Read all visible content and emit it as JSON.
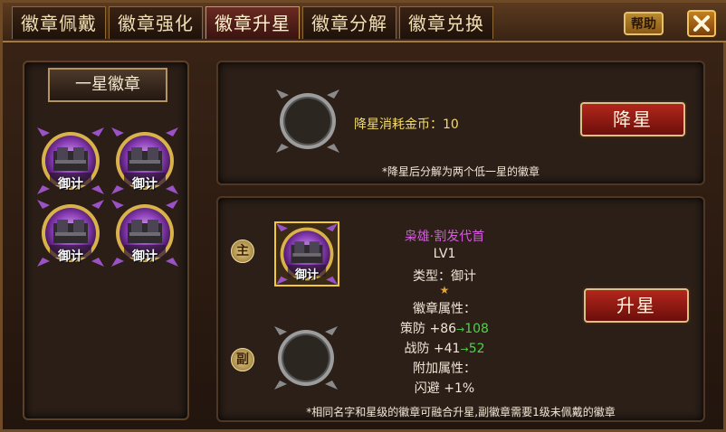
{
  "tabs": [
    {
      "label": "徽章佩戴",
      "active": false
    },
    {
      "label": "徽章强化",
      "active": false
    },
    {
      "label": "徽章升星",
      "active": true
    },
    {
      "label": "徽章分解",
      "active": false
    },
    {
      "label": "徽章兑换",
      "active": false
    }
  ],
  "help_label": "帮助",
  "close_icon": "close-x-icon",
  "left_panel": {
    "grade_label": "一星徽章",
    "badges": [
      {
        "text": "御计"
      },
      {
        "text": "御计"
      },
      {
        "text": "御计"
      },
      {
        "text": "御计"
      }
    ]
  },
  "downgrade": {
    "cost_label": "降星消耗金币：10",
    "button_label": "降星",
    "note": "*降星后分解为两个低一星的徽章"
  },
  "upgrade": {
    "main_label": "主",
    "sub_label": "副",
    "main_badge_text": "御计",
    "badge_name": "枭雄·割发代首",
    "level": "LV1",
    "type": "类型：御计",
    "stars": 1,
    "attr_title": "徽章属性：",
    "attr1_name": "策防 +86",
    "attr1_next": "108",
    "attr2_name": "战防 +41",
    "attr2_next": "52",
    "extra_title": "附加属性：",
    "extra1": "闪避 +1%",
    "button_label": "升星",
    "note": "*相同名字和星级的徽章可融合升星,副徽章需要1级未佩戴的徽章"
  },
  "colors": {
    "badge_purple": "#7a3aa8",
    "badge_gold": "#d9b24a",
    "name_pink": "#d65ae0",
    "increase_green": "#4fd24a"
  }
}
